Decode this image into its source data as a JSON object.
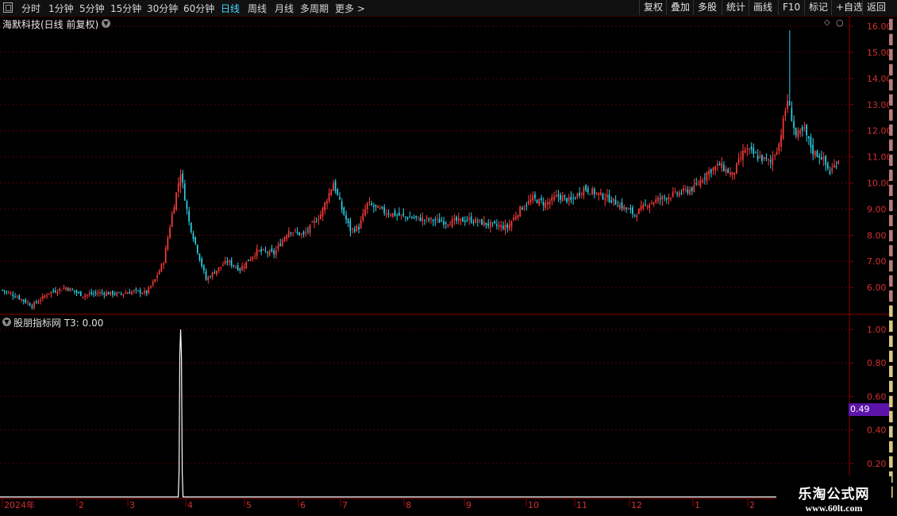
{
  "toolbar": {
    "periods": [
      "分时",
      "1分钟",
      "5分钟",
      "15分钟",
      "30分钟",
      "60分钟",
      "日线",
      "周线",
      "月线",
      "多周期",
      "更多"
    ],
    "active_period": "日线",
    "more_arrow": ">",
    "buttons": [
      "复权",
      "叠加",
      "多股",
      "统计",
      "画线",
      "F10",
      "标记",
      "+自选",
      "返回"
    ]
  },
  "main_panel": {
    "title": "海默科技(日线 前复权)",
    "price_ticks": [
      "16.00",
      "15.00",
      "14.00",
      "13.00",
      "12.00",
      "11.00",
      "10.00",
      "9.00",
      "8.00",
      "7.00",
      "6.00"
    ]
  },
  "indicator_panel": {
    "title": "股朋指标网  T3: 0.00",
    "ticks": [
      "1.00",
      "0.80",
      "0.60",
      "0.40",
      "0.20"
    ],
    "current_value": "0.49"
  },
  "time_axis": {
    "labels": [
      "2024年",
      "2",
      "3",
      "4",
      "5",
      "6",
      "7",
      "8",
      "9",
      "10",
      "11",
      "12",
      "1",
      "2"
    ]
  },
  "watermark": {
    "name": "乐淘公式网",
    "url": "www.60lt.com"
  },
  "colors": {
    "up": "#ff3b3b",
    "down": "#29d3e8",
    "grid": "#5a0000",
    "axis_text": "#d23030",
    "highlight": "#5b13a8"
  },
  "chart_data": {
    "type": "candlestick",
    "y_range": [
      5.0,
      16.4
    ],
    "indicator_y_range": [
      0,
      1.0
    ],
    "anchors": [
      [
        0,
        5.9
      ],
      [
        8,
        5.6
      ],
      [
        14,
        5.3
      ],
      [
        22,
        5.8
      ],
      [
        30,
        6.0
      ],
      [
        38,
        5.7
      ],
      [
        46,
        5.8
      ],
      [
        55,
        5.75
      ],
      [
        62,
        5.85
      ],
      [
        68,
        5.8
      ],
      [
        72,
        6.3
      ],
      [
        76,
        7.0
      ],
      [
        80,
        8.8
      ],
      [
        84,
        10.4
      ],
      [
        88,
        8.5
      ],
      [
        92,
        7.4
      ],
      [
        96,
        6.3
      ],
      [
        100,
        6.6
      ],
      [
        106,
        7.0
      ],
      [
        112,
        6.7
      ],
      [
        120,
        7.4
      ],
      [
        128,
        7.3
      ],
      [
        135,
        8.2
      ],
      [
        142,
        8.0
      ],
      [
        150,
        8.8
      ],
      [
        156,
        10.0
      ],
      [
        160,
        9.0
      ],
      [
        164,
        8.2
      ],
      [
        168,
        8.3
      ],
      [
        172,
        9.2
      ],
      [
        180,
        8.9
      ],
      [
        190,
        8.7
      ],
      [
        200,
        8.6
      ],
      [
        210,
        8.5
      ],
      [
        220,
        8.6
      ],
      [
        230,
        8.4
      ],
      [
        238,
        8.3
      ],
      [
        244,
        9.0
      ],
      [
        250,
        9.4
      ],
      [
        256,
        9.2
      ],
      [
        262,
        9.5
      ],
      [
        268,
        9.3
      ],
      [
        274,
        9.8
      ],
      [
        280,
        9.6
      ],
      [
        286,
        9.4
      ],
      [
        292,
        9.1
      ],
      [
        298,
        8.8
      ],
      [
        304,
        9.2
      ],
      [
        310,
        9.4
      ],
      [
        318,
        9.6
      ],
      [
        326,
        9.8
      ],
      [
        332,
        10.4
      ],
      [
        338,
        10.7
      ],
      [
        344,
        10.3
      ],
      [
        350,
        11.3
      ],
      [
        356,
        11.0
      ],
      [
        362,
        10.8
      ],
      [
        366,
        11.5
      ],
      [
        370,
        13.2
      ],
      [
        374,
        11.8
      ],
      [
        378,
        12.0
      ],
      [
        382,
        11.2
      ],
      [
        386,
        11.0
      ],
      [
        390,
        10.4
      ],
      [
        394,
        10.9
      ]
    ],
    "spike_candle": 371,
    "spike_high": 15.85,
    "indicator_spike": {
      "candle": 84,
      "value": 1.0
    }
  }
}
